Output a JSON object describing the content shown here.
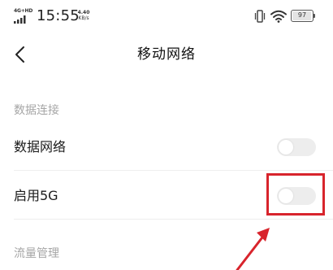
{
  "status_bar": {
    "network_type": "4G+HD",
    "time": "15:55",
    "net_speed_value": "4.40",
    "net_speed_unit": "KB/s",
    "battery": "97",
    "battery_level": 0.97
  },
  "nav": {
    "back_icon": "chevron-left-icon",
    "title": "移动网络"
  },
  "sections": {
    "data_connection": {
      "header": "数据连接",
      "rows": [
        {
          "label": "数据网络",
          "toggle_on": false
        },
        {
          "label": "启用5G",
          "toggle_on": false
        }
      ]
    },
    "traffic": {
      "header": "流量管理"
    }
  },
  "annotation": {
    "highlight_color": "#d8242c",
    "arrow_color": "#d8242c"
  }
}
